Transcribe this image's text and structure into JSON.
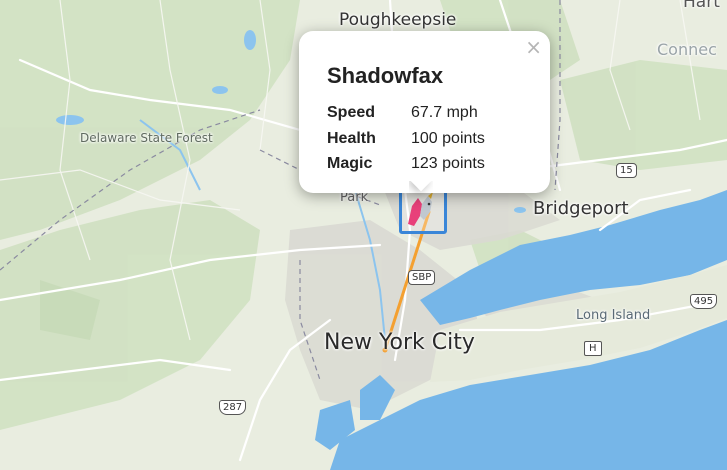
{
  "map": {
    "labels": {
      "poughkeepsie": "Poughkeepsie",
      "hartford": "Hart",
      "connecticut": "Connec",
      "delaware_forest": "Delaware State Forest",
      "park_fragment": "Park",
      "bridgeport": "Bridgeport",
      "new_york_city": "New York City",
      "long_island": "Long Island",
      "sbp": "SBP"
    },
    "shields": {
      "route15": "15",
      "i495": "495",
      "i287": "287",
      "h": "H"
    },
    "colors": {
      "water": "#76b6e8",
      "land": "#e9ede0",
      "forest": "#cfe0c0",
      "urban": "#dcdcd6",
      "route_line": "#f4a030",
      "marker_border": "#3a86d8"
    }
  },
  "popup": {
    "title": "Shadowfax",
    "close_icon": "×",
    "stats": [
      {
        "label": "Speed",
        "value": "67.7 mph"
      },
      {
        "label": "Health",
        "value": "100 points"
      },
      {
        "label": "Magic",
        "value": "123 points"
      }
    ]
  }
}
